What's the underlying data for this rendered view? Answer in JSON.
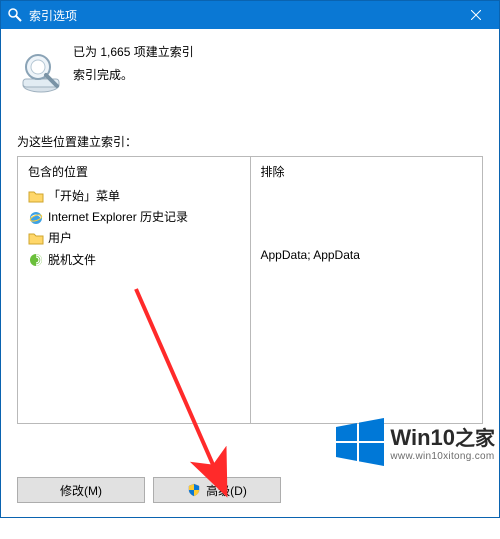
{
  "titlebar": {
    "title": "索引选项",
    "close_label": "X"
  },
  "status": {
    "count": "1,665",
    "line1": "已为 1,665 项建立索引",
    "line2": "索引完成。"
  },
  "labels": {
    "section": "为这些位置建立索引：",
    "col_included": "包含的位置",
    "col_excluded": "排除"
  },
  "included_items": [
    {
      "icon": "folder-icon",
      "label": "「开始」菜单"
    },
    {
      "icon": "ie-icon",
      "label": "Internet Explorer 历史记录"
    },
    {
      "icon": "folder-icon",
      "label": "用户"
    },
    {
      "icon": "offline-files-icon",
      "label": "脱机文件"
    }
  ],
  "excluded": {
    "text": "AppData; AppData"
  },
  "buttons": {
    "modify": "修改(M)",
    "advanced": "高级(D)"
  },
  "watermark": {
    "brand": "Win10",
    "suffix": "之家",
    "url": "www.win10xitong.com"
  },
  "colors": {
    "title": "#0a78d4",
    "arrow": "#ff2a2a",
    "logo": "#0078d7"
  }
}
